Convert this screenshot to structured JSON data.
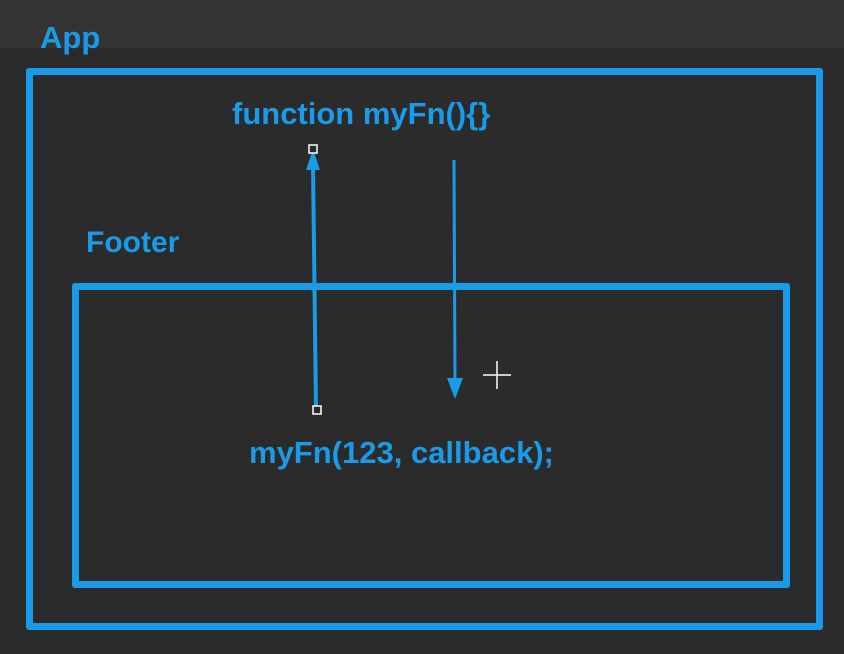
{
  "colors": {
    "accent": "#1a9be8",
    "background": "#2b2b2b",
    "cursor": "#ffffff"
  },
  "labels": {
    "app": "App",
    "footer": "Footer",
    "function_decl": "function myFn(){}",
    "function_call": "myFn(123, callback);"
  },
  "icons": {
    "cursor": "crosshair-cursor-icon"
  }
}
